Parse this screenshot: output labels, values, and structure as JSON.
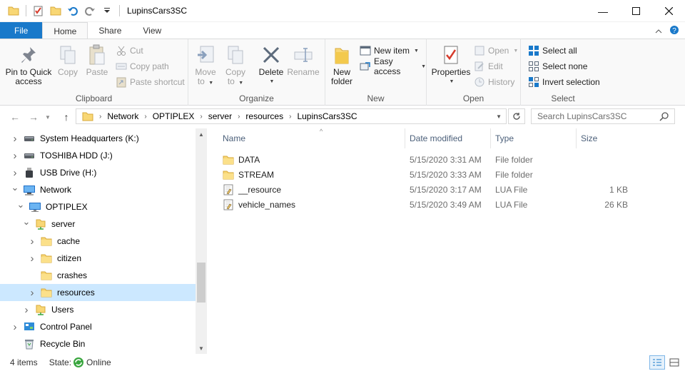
{
  "window": {
    "title": "LupinsCars3SC",
    "controls": [
      "minimize-icon",
      "maximize-icon",
      "close-icon"
    ]
  },
  "ribbon_tabs": [
    {
      "label": "File"
    },
    {
      "label": "Home"
    },
    {
      "label": "Share"
    },
    {
      "label": "View"
    }
  ],
  "ribbon": {
    "clipboard": {
      "label": "Clipboard",
      "pin": "Pin to Quick access",
      "pin_line1": "Pin to Quick",
      "pin_line2": "access",
      "copy": "Copy",
      "paste": "Paste",
      "cut": "Cut",
      "copy_path": "Copy path",
      "paste_shortcut": "Paste shortcut"
    },
    "organize": {
      "label": "Organize",
      "move_to_1": "Move",
      "move_to_2": "to",
      "copy_to_1": "Copy",
      "copy_to_2": "to",
      "delete": "Delete",
      "rename": "Rename"
    },
    "new": {
      "label": "New",
      "new_folder_1": "New",
      "new_folder_2": "folder",
      "new_item": "New item",
      "easy_access": "Easy access"
    },
    "open": {
      "label": "Open",
      "properties": "Properties",
      "open": "Open",
      "edit": "Edit",
      "history": "History"
    },
    "select": {
      "label": "Select",
      "select_all": "Select all",
      "select_none": "Select none",
      "invert": "Invert selection"
    }
  },
  "address": {
    "crumbs": [
      "Network",
      "OPTIPLEX",
      "server",
      "resources",
      "LupinsCars3SC"
    ],
    "search_placeholder": "Search LupinsCars3SC"
  },
  "nav_tree": [
    {
      "label": "System Headquarters (K:)",
      "icon": "drive-icon",
      "indent": 0,
      "twisty": "collapsed"
    },
    {
      "label": "TOSHIBA HDD (J:)",
      "icon": "drive-icon",
      "indent": 0,
      "twisty": "collapsed"
    },
    {
      "label": "USB Drive (H:)",
      "icon": "usb-icon",
      "indent": 0,
      "twisty": "collapsed"
    },
    {
      "label": "Network",
      "icon": "network-icon",
      "indent": 0,
      "twisty": "expanded"
    },
    {
      "label": "OPTIPLEX",
      "icon": "computer-icon",
      "indent": 1,
      "twisty": "expanded"
    },
    {
      "label": "server",
      "icon": "shared-folder-icon",
      "indent": 2,
      "twisty": "expanded"
    },
    {
      "label": "cache",
      "icon": "folder-icon",
      "indent": 3,
      "twisty": "collapsed"
    },
    {
      "label": "citizen",
      "icon": "folder-icon",
      "indent": 3,
      "twisty": "collapsed"
    },
    {
      "label": "crashes",
      "icon": "folder-icon",
      "indent": 3,
      "twisty": "none"
    },
    {
      "label": "resources",
      "icon": "folder-icon",
      "indent": 3,
      "twisty": "collapsed",
      "selected": true
    },
    {
      "label": "Users",
      "icon": "shared-folder-icon",
      "indent": 2,
      "twisty": "collapsed"
    },
    {
      "label": "Control Panel",
      "icon": "control-panel-icon",
      "indent": 0,
      "twisty": "collapsed"
    },
    {
      "label": "Recycle Bin",
      "icon": "recycle-bin-icon",
      "indent": 0,
      "twisty": "none"
    }
  ],
  "columns": [
    "Name",
    "Date modified",
    "Type",
    "Size"
  ],
  "files": [
    {
      "name": "DATA",
      "date": "5/15/2020 3:31 AM",
      "type": "File folder",
      "size": "",
      "icon": "folder-icon"
    },
    {
      "name": "STREAM",
      "date": "5/15/2020 3:33 AM",
      "type": "File folder",
      "size": "",
      "icon": "folder-icon"
    },
    {
      "name": "__resource",
      "date": "5/15/2020 3:17 AM",
      "type": "LUA File",
      "size": "1 KB",
      "icon": "lua-file-icon"
    },
    {
      "name": "vehicle_names",
      "date": "5/15/2020 3:49 AM",
      "type": "LUA File",
      "size": "26 KB",
      "icon": "lua-file-icon"
    }
  ],
  "status": {
    "item_count": "4 items",
    "state_label": "State:",
    "state_value": "Online"
  },
  "colors": {
    "accent": "#1979ca",
    "selection": "#cce8ff",
    "folder": "#f8d775",
    "header_text": "#4c607a"
  }
}
